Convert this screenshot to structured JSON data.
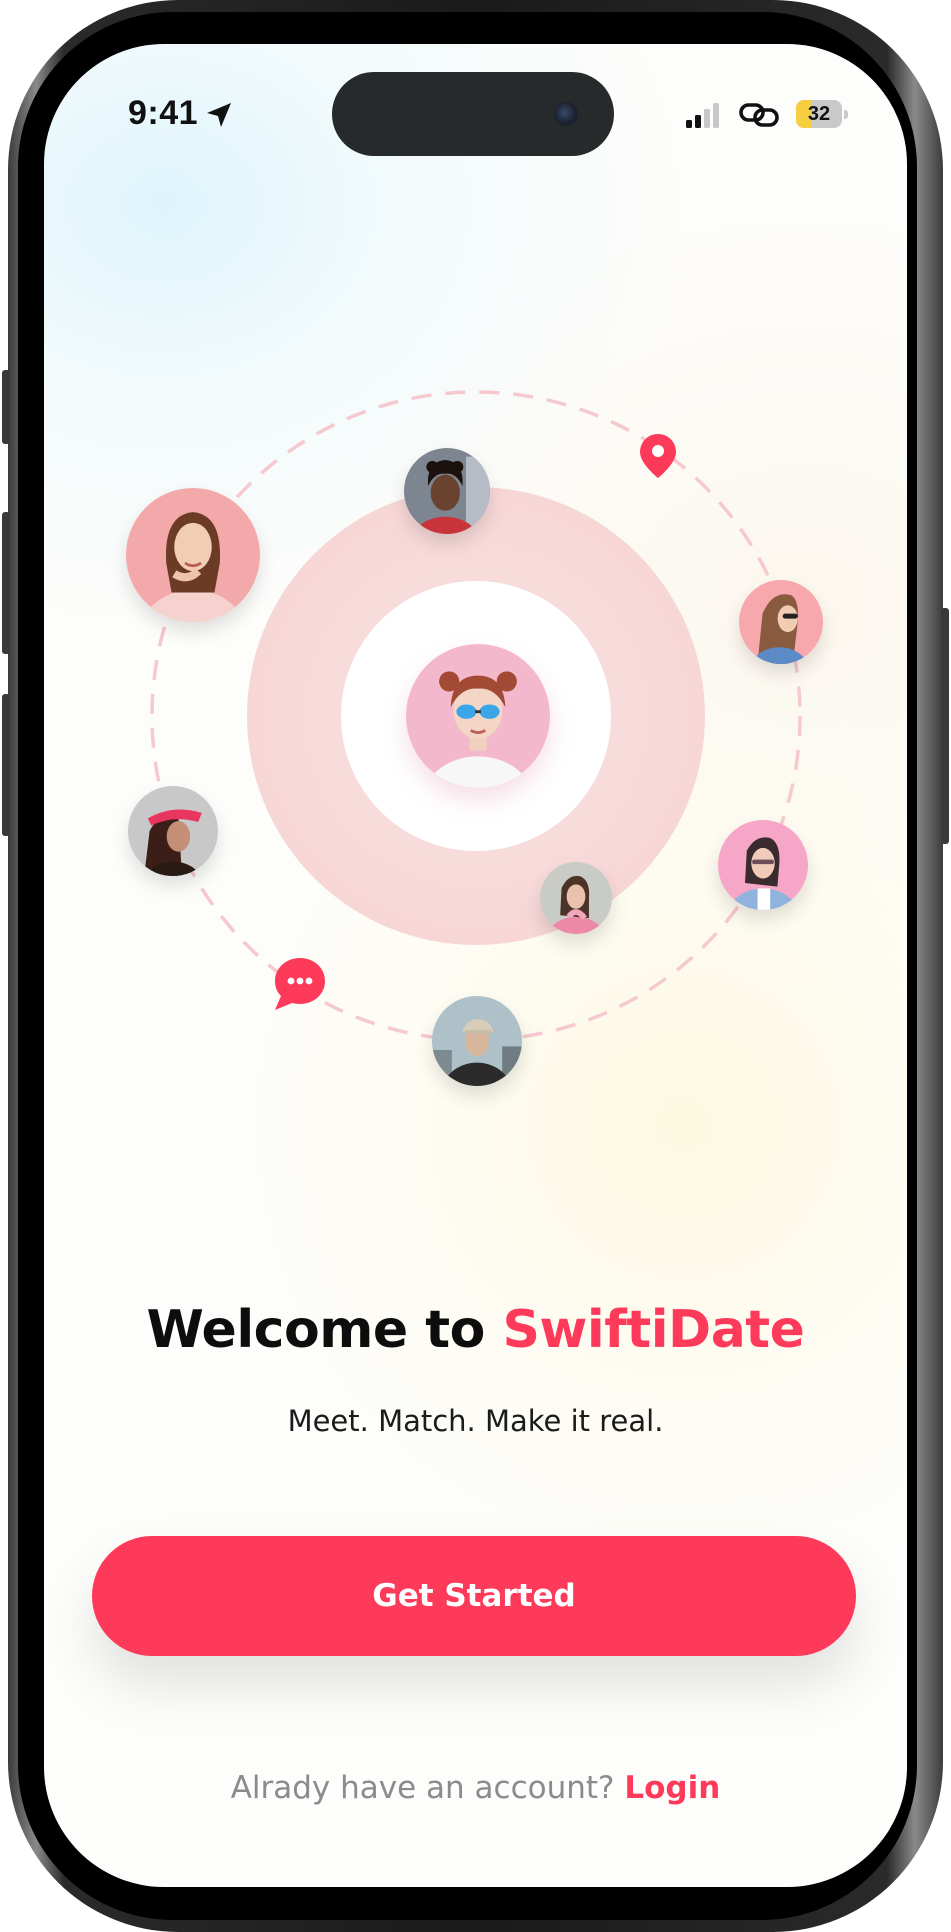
{
  "status_bar": {
    "time": "9:41",
    "battery_level": "32",
    "battery_fraction": 0.32,
    "icons": [
      "location-arrow-icon",
      "cellular-signal-icon",
      "link-icon",
      "battery-icon"
    ]
  },
  "hero": {
    "center_avatar": "user-with-sunglasses",
    "orbit_avatars": [
      "woman-hand-on-chin",
      "young-man-curly-hair",
      "woman-with-sunglasses-profile",
      "woman-pink-visor",
      "woman-blue-jacket-glasses",
      "woman-pink-hoodie",
      "man-in-cap-leather-jacket"
    ],
    "floating_icons": [
      "location-pin-icon",
      "chat-bubble-icon"
    ]
  },
  "welcome": {
    "title_prefix": "Welcome to ",
    "brand": "SwiftiDate",
    "tagline": "Meet. Match. Make it real."
  },
  "cta": {
    "label": "Get Started"
  },
  "login": {
    "prompt": "Alrady have an account?",
    "link_label": "Login"
  },
  "colors": {
    "brand": "#fd3a5a",
    "title": "#0d0d0d",
    "muted": "#8b8b8b",
    "ring": "#f8d9d9",
    "dashed_orbit": "#f5c9cf"
  }
}
